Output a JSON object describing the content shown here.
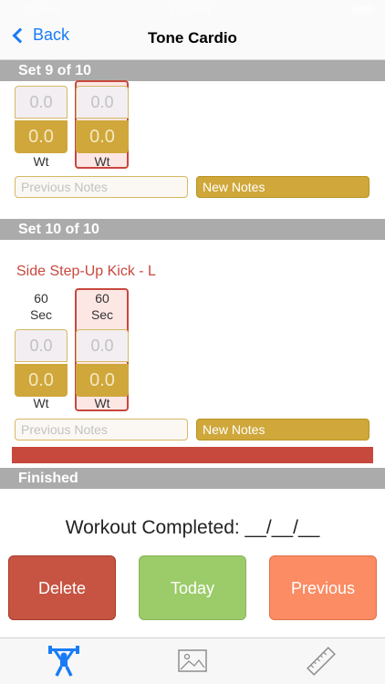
{
  "status": {
    "carrier": "Carrier",
    "time": "6:07 AM"
  },
  "nav": {
    "back_label": "Back",
    "title": "Tone Cardio"
  },
  "set9": {
    "header": "Set 9 of 10",
    "left_input": "0.0",
    "left_value": "0.0",
    "left_label": "Wt",
    "right_input": "0.0",
    "right_value": "0.0",
    "right_label": "Wt",
    "prev_notes_placeholder": "Previous Notes",
    "new_notes_label": "New Notes"
  },
  "set10": {
    "header": "Set 10 of 10",
    "exercise": "Side Step-Up Kick - L",
    "left_sec_value": "60",
    "left_sec_unit": "Sec",
    "right_sec_value": "60",
    "right_sec_unit": "Sec",
    "left_input": "0.0",
    "left_value": "0.0",
    "left_label": "Wt",
    "right_input": "0.0",
    "right_value": "0.0",
    "right_label": "Wt",
    "prev_notes_placeholder": "Previous Notes",
    "new_notes_label": "New Notes"
  },
  "finished": {
    "header": "Finished",
    "completed_text": "Workout Completed: __/__/__"
  },
  "buttons": {
    "delete": "Delete",
    "today": "Today",
    "previous": "Previous"
  },
  "tabs": [
    {
      "icon": "weightlifter-icon",
      "active": true
    },
    {
      "icon": "image-icon",
      "active": false
    },
    {
      "icon": "ruler-icon",
      "active": false
    }
  ],
  "colors": {
    "accent": "#1a7cf5",
    "gold": "#cfa73a",
    "red": "#c7483d",
    "green": "#9ccc6a",
    "orange": "#fb8c63"
  }
}
